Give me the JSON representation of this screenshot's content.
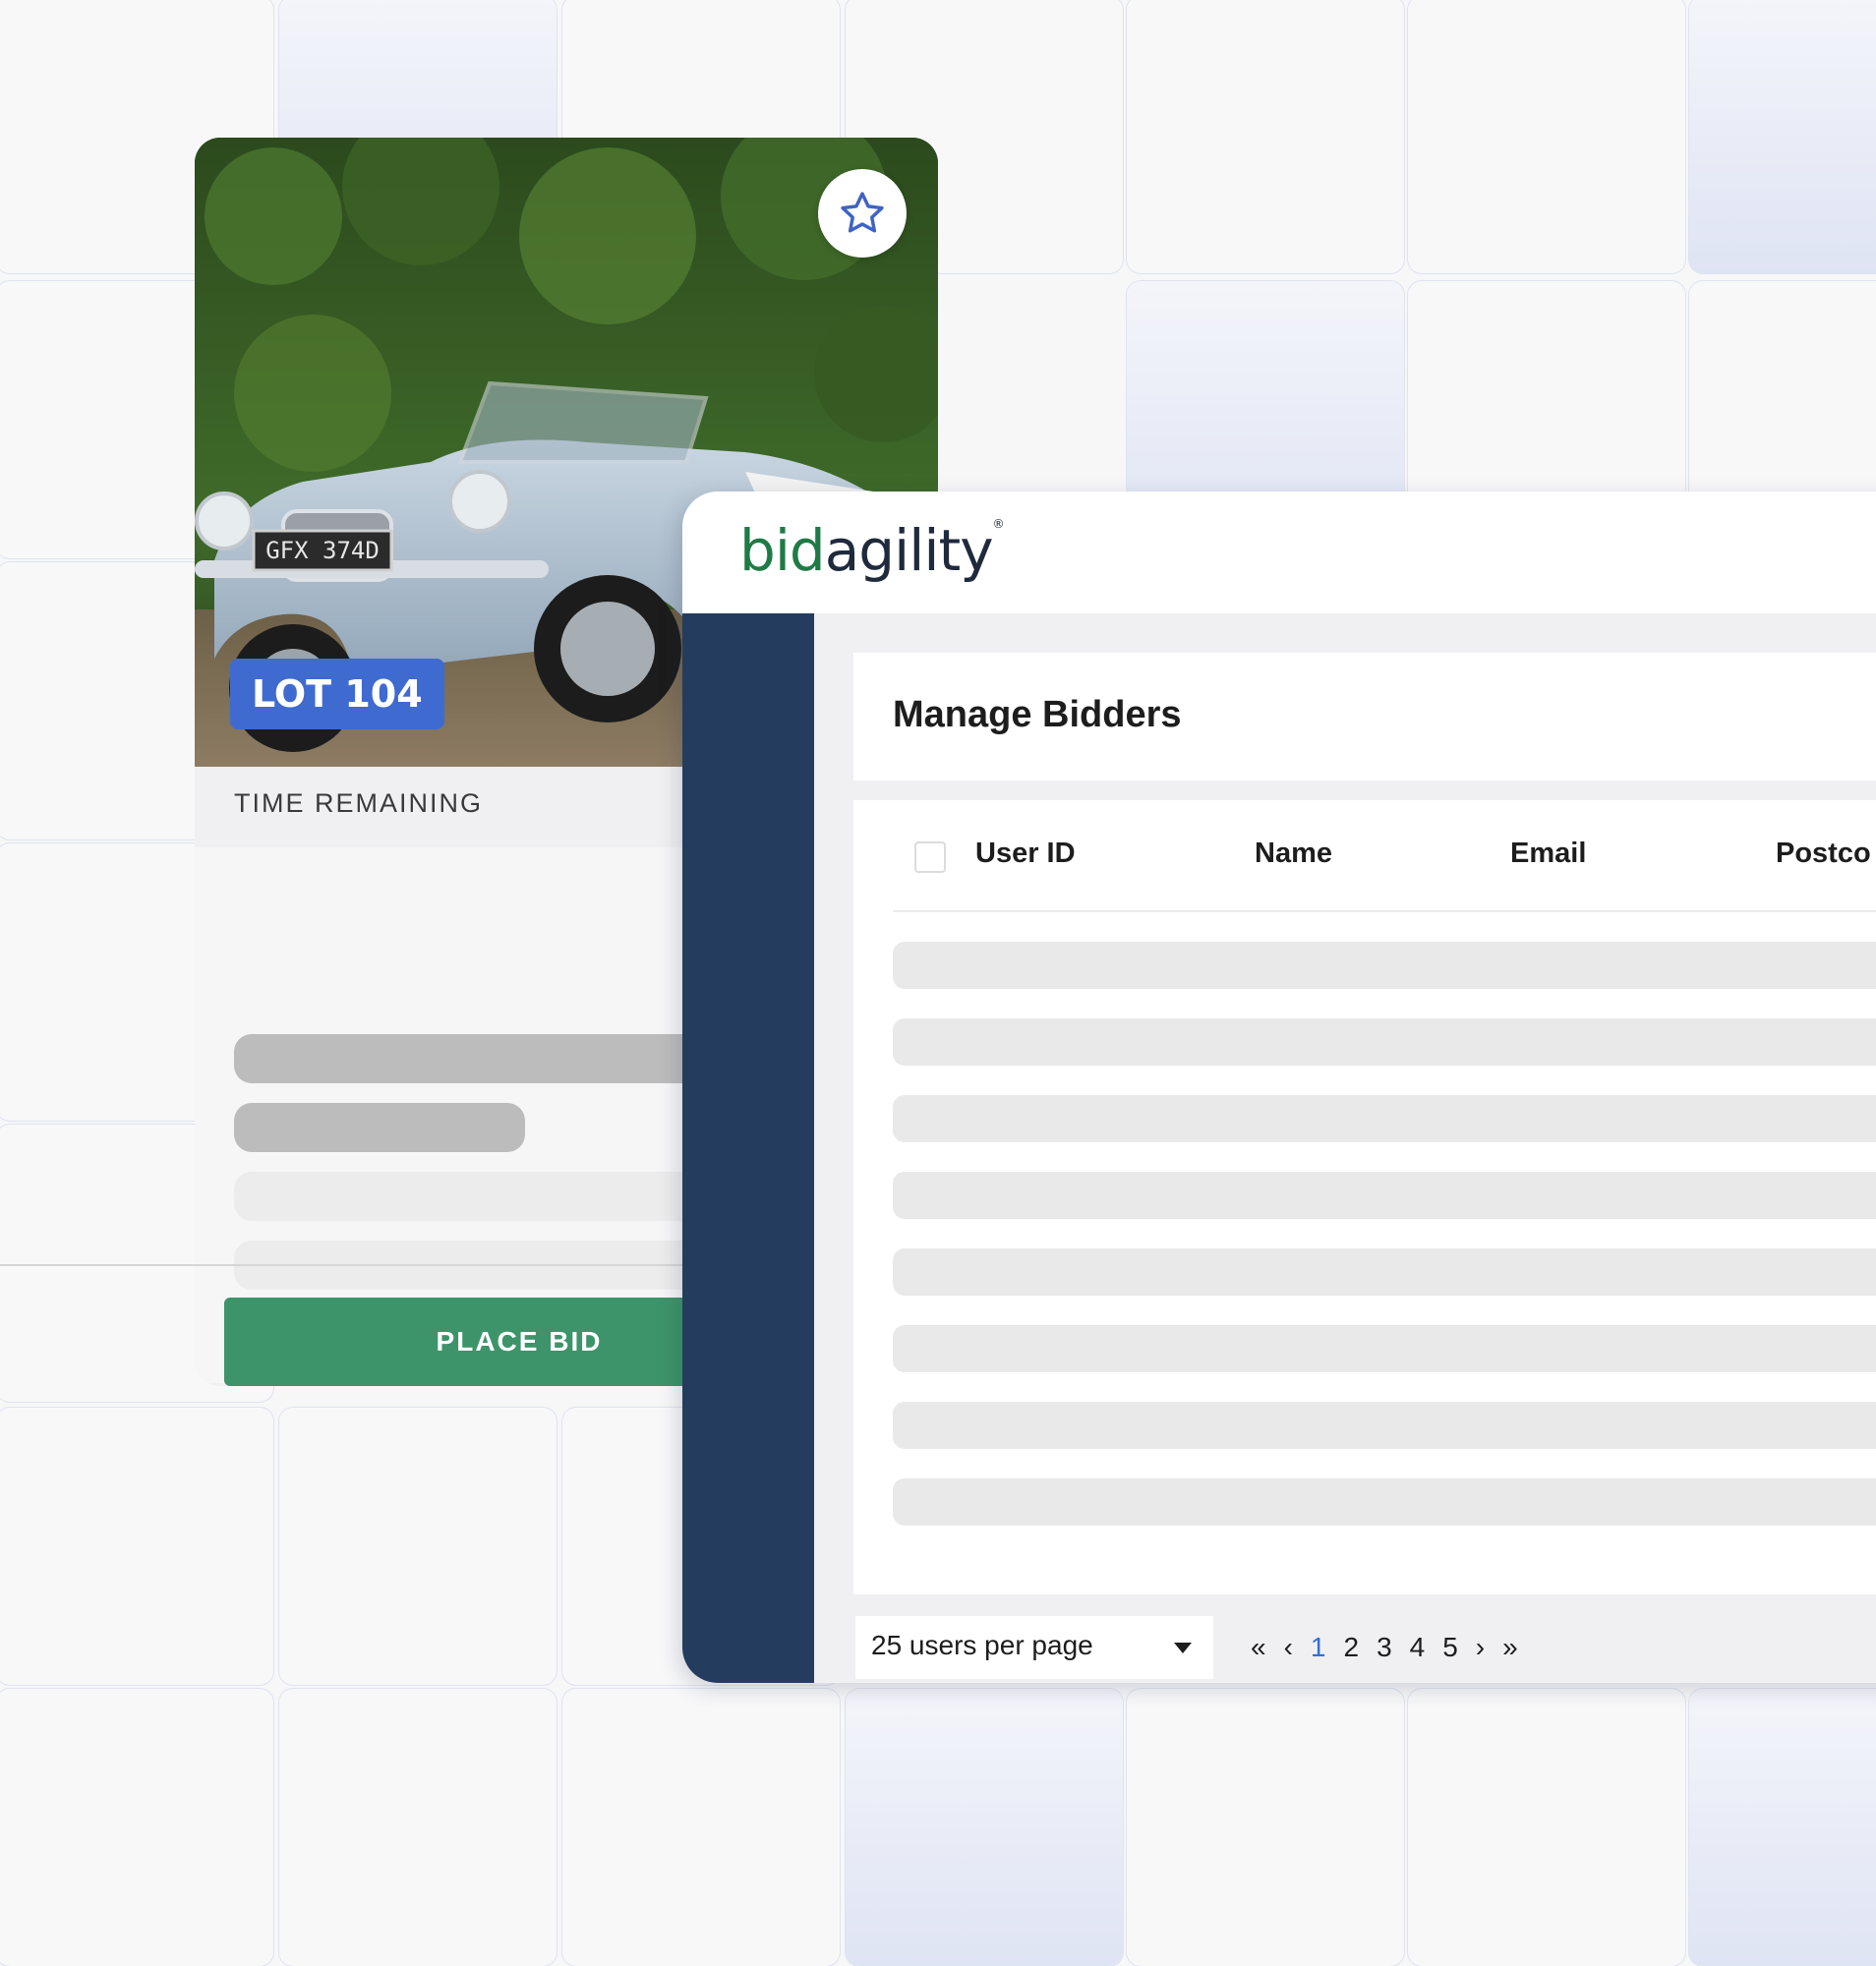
{
  "lot_card": {
    "lot_badge": "LOT 104",
    "time_label": "TIME REMAINING",
    "place_bid_label": "PLACE BID",
    "license_plate": "GFX 374D"
  },
  "admin": {
    "logo_bid": "bid",
    "logo_agility": "agility",
    "logo_reg": "®",
    "page_title": "Manage Bidders",
    "columns": [
      "User ID",
      "Name",
      "Email",
      "Postco"
    ],
    "per_page": "25 users per page",
    "pagination": {
      "first": "«",
      "prev": "‹",
      "pages": [
        "1",
        "2",
        "3",
        "4",
        "5"
      ],
      "active_page": "1",
      "next": "›",
      "last": "»"
    }
  },
  "colors": {
    "lot_badge": "#3f6bd0",
    "place_bid": "#3e946a",
    "sidebar": "#243c5e",
    "logo_green": "#1f7a45",
    "active_page": "#2f6fd8"
  }
}
